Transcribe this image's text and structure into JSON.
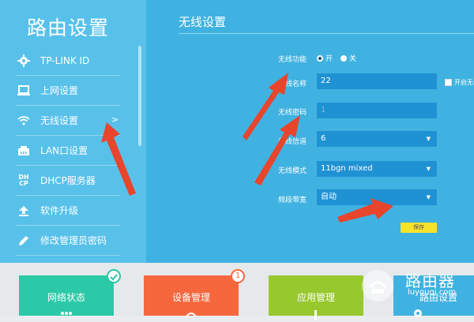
{
  "sidebar": {
    "title": "路由设置",
    "items": [
      {
        "label": "TP-LINK ID"
      },
      {
        "label": "上网设置"
      },
      {
        "label": "无线设置",
        "chevron": ">"
      },
      {
        "label": "LAN口设置"
      },
      {
        "label": "DHCP服务器"
      },
      {
        "label": "软件升级"
      },
      {
        "label": "修改管理员密码"
      }
    ],
    "dhcp_icon_text": "DH\nCP"
  },
  "main": {
    "section_title": "无线设置",
    "form": {
      "wireless_function": {
        "label": "无线功能",
        "option_on": "开",
        "option_off": "关",
        "selected": "开"
      },
      "wireless_name": {
        "label": "无线名称",
        "value": "22"
      },
      "wireless_password": {
        "label": "无线密码",
        "value": "1"
      },
      "channel": {
        "label": "无线信道",
        "value": "6"
      },
      "mode": {
        "label": "无线模式",
        "value": "11bgn mixed"
      },
      "bandwidth": {
        "label": "频段带宽",
        "value": "自动"
      },
      "checkbox_label": "开启无线",
      "save_label": "保存"
    }
  },
  "tiles": [
    {
      "label": "网络状态",
      "color": "#2bc9a7"
    },
    {
      "label": "设备管理",
      "color": "#f6673e",
      "badge": "1"
    },
    {
      "label": "应用管理",
      "color": "#97c82d"
    },
    {
      "label": "路由设置",
      "color": "#3fb2e1"
    }
  ],
  "watermark": {
    "text": "路由器",
    "subtext": "luyouqi.com"
  },
  "colors": {
    "sidebar": "#58c1ea",
    "main": "#3fb2e1",
    "field": "#1f92d4",
    "save": "#f6e22b",
    "arrow": "#e8452d"
  }
}
